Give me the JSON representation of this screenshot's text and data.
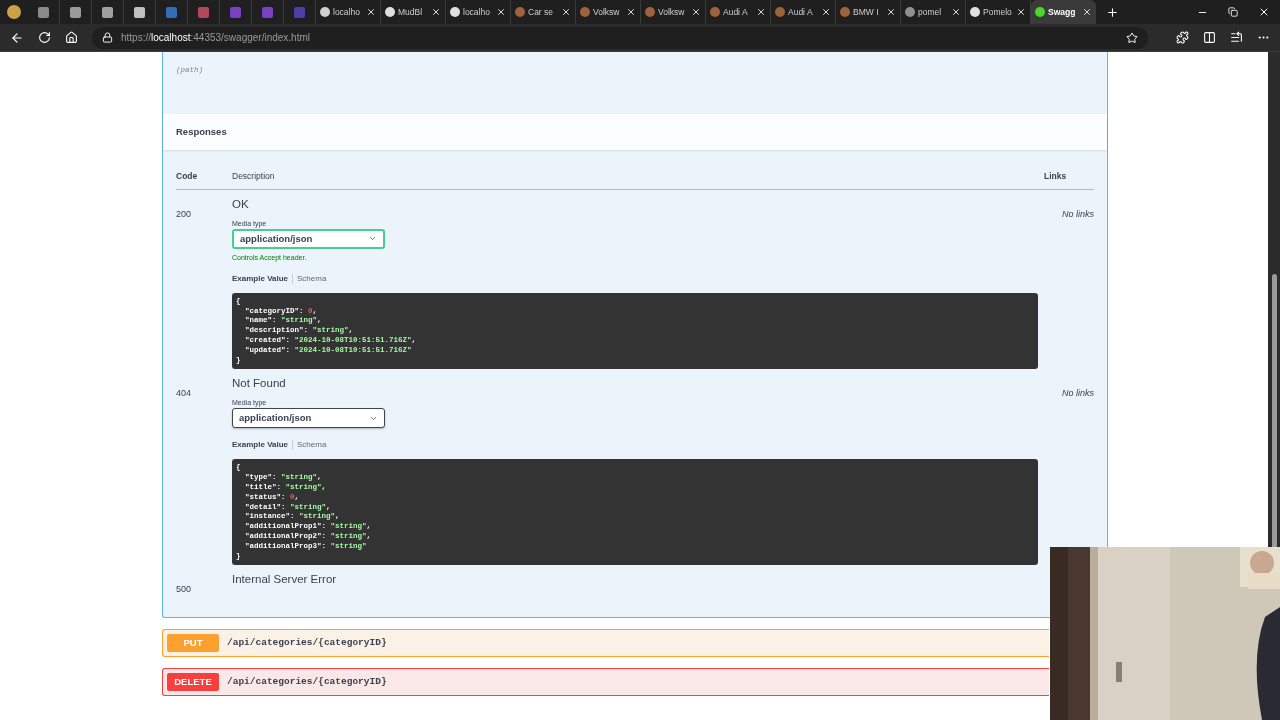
{
  "browser": {
    "tabs": [
      {
        "kind": "pinned",
        "color": "#8a8a8a"
      },
      {
        "kind": "pinned",
        "color": "#9a9a9a"
      },
      {
        "kind": "pinned",
        "color": "#a0a0a0"
      },
      {
        "kind": "pinned",
        "color": "#c0c0c0"
      },
      {
        "kind": "pinned",
        "color": "#2f6db5"
      },
      {
        "kind": "pinned",
        "color": "#b0485a"
      },
      {
        "kind": "pinned",
        "color": "#7a3fc4"
      },
      {
        "kind": "pinned",
        "color": "#7a3fc4"
      },
      {
        "kind": "pinned",
        "color": "#4b3fa8"
      },
      {
        "kind": "page",
        "label": "localho",
        "color": "#d0d0d0",
        "selected": false
      },
      {
        "kind": "page",
        "label": "MudBl",
        "color": "#e0e0e0",
        "selected": false
      },
      {
        "kind": "page",
        "label": "localho",
        "color": "#e0e0e0",
        "selected": false
      },
      {
        "kind": "page",
        "label": "Car se",
        "color": "#a0623a",
        "selected": false
      },
      {
        "kind": "page",
        "label": "Volksw",
        "color": "#a0623a",
        "selected": false
      },
      {
        "kind": "page",
        "label": "Volksw",
        "color": "#a0623a",
        "selected": false
      },
      {
        "kind": "page",
        "label": "Audi A",
        "color": "#a0623a",
        "selected": false
      },
      {
        "kind": "page",
        "label": "Audi A",
        "color": "#a0623a",
        "selected": false
      },
      {
        "kind": "page",
        "label": "BMW I",
        "color": "#a0623a",
        "selected": false
      },
      {
        "kind": "page",
        "label": "pomel",
        "color": "#909090",
        "selected": false
      },
      {
        "kind": "page",
        "label": "Pomelo",
        "color": "#e0e0e0",
        "selected": false
      },
      {
        "kind": "page",
        "label": "Swagg",
        "color": "#4cd62b",
        "selected": true
      }
    ],
    "url": [
      {
        "text": "https://",
        "kind": "dim"
      },
      {
        "text": "localhost",
        "kind": "host"
      },
      {
        "text": ":44353/swagger/index.html",
        "kind": "dim"
      }
    ]
  },
  "operation": {
    "parameter_location": "(path)",
    "responses_title": "Responses",
    "columns": [
      "Code",
      "Description",
      "Links"
    ],
    "responses": [
      {
        "code": "200",
        "description": "OK",
        "links": "No links",
        "media": {
          "label": "Media type",
          "value": "application/json",
          "focused": true,
          "hint": "Controls Accept header."
        },
        "tabs": [
          {
            "label": "Example Value",
            "selected": true
          },
          {
            "label": "Schema",
            "selected": false
          }
        ],
        "example": [
          [
            {
              "text": "{",
              "kind": "punct"
            }
          ],
          [
            {
              "text": "  \"categoryID\": ",
              "kind": "key"
            },
            {
              "text": "0",
              "kind": "number"
            },
            {
              "text": ",",
              "kind": "punct"
            }
          ],
          [
            {
              "text": "  \"name\": ",
              "kind": "key"
            },
            {
              "text": "\"string\"",
              "kind": "string"
            },
            {
              "text": ",",
              "kind": "punct"
            }
          ],
          [
            {
              "text": "  \"description\": ",
              "kind": "key"
            },
            {
              "text": "\"string\"",
              "kind": "string"
            },
            {
              "text": ",",
              "kind": "punct"
            }
          ],
          [
            {
              "text": "  \"created\": ",
              "kind": "key"
            },
            {
              "text": "\"2024-10-08T10:51:51.716Z\"",
              "kind": "string"
            },
            {
              "text": ",",
              "kind": "punct"
            }
          ],
          [
            {
              "text": "  \"updated\": ",
              "kind": "key"
            },
            {
              "text": "\"2024-10-08T10:51:51.716Z\"",
              "kind": "string"
            }
          ],
          [
            {
              "text": "}",
              "kind": "punct"
            }
          ]
        ]
      },
      {
        "code": "404",
        "description": "Not Found",
        "links": "No links",
        "media": {
          "label": "Media type",
          "value": "application/json",
          "focused": false
        },
        "tabs": [
          {
            "label": "Example Value",
            "selected": true
          },
          {
            "label": "Schema",
            "selected": false
          }
        ],
        "example": [
          [
            {
              "text": "{",
              "kind": "punct"
            }
          ],
          [
            {
              "text": "  \"type\": ",
              "kind": "key"
            },
            {
              "text": "\"string\"",
              "kind": "string"
            },
            {
              "text": ",",
              "kind": "punct"
            }
          ],
          [
            {
              "text": "  \"title\": ",
              "kind": "key"
            },
            {
              "text": "\"string\"",
              "kind": "string"
            },
            {
              "text": ",",
              "kind": "punct"
            }
          ],
          [
            {
              "text": "  \"status\": ",
              "kind": "key"
            },
            {
              "text": "0",
              "kind": "number"
            },
            {
              "text": ",",
              "kind": "punct"
            }
          ],
          [
            {
              "text": "  \"detail\": ",
              "kind": "key"
            },
            {
              "text": "\"string\"",
              "kind": "string"
            },
            {
              "text": ",",
              "kind": "punct"
            }
          ],
          [
            {
              "text": "  \"instance\": ",
              "kind": "key"
            },
            {
              "text": "\"string\"",
              "kind": "string"
            },
            {
              "text": ",",
              "kind": "punct"
            }
          ],
          [
            {
              "text": "  \"additionalProp1\": ",
              "kind": "key"
            },
            {
              "text": "\"string\"",
              "kind": "string"
            },
            {
              "text": ",",
              "kind": "punct"
            }
          ],
          [
            {
              "text": "  \"additionalProp2\": ",
              "kind": "key"
            },
            {
              "text": "\"string\"",
              "kind": "string"
            },
            {
              "text": ",",
              "kind": "punct"
            }
          ],
          [
            {
              "text": "  \"additionalProp3\": ",
              "kind": "key"
            },
            {
              "text": "\"string\"",
              "kind": "string"
            }
          ],
          [
            {
              "text": "}",
              "kind": "punct"
            }
          ]
        ]
      },
      {
        "code": "500",
        "description": "Internal Server Error"
      }
    ]
  },
  "endpoints": [
    {
      "method": "PUT",
      "path": "/api/categories/{categoryID}"
    },
    {
      "method": "DELETE",
      "path": "/api/categories/{categoryID}"
    }
  ]
}
